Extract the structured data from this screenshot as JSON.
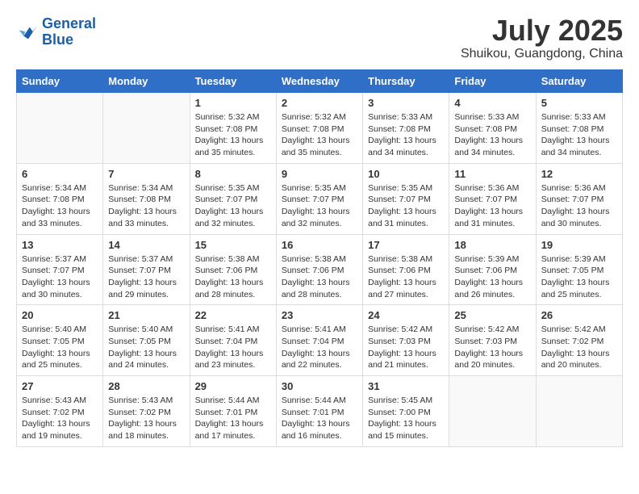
{
  "logo": {
    "line1": "General",
    "line2": "Blue"
  },
  "title": "July 2025",
  "location": "Shuikou, Guangdong, China",
  "headers": [
    "Sunday",
    "Monday",
    "Tuesday",
    "Wednesday",
    "Thursday",
    "Friday",
    "Saturday"
  ],
  "weeks": [
    [
      {
        "day": "",
        "info": ""
      },
      {
        "day": "",
        "info": ""
      },
      {
        "day": "1",
        "info": "Sunrise: 5:32 AM\nSunset: 7:08 PM\nDaylight: 13 hours\nand 35 minutes."
      },
      {
        "day": "2",
        "info": "Sunrise: 5:32 AM\nSunset: 7:08 PM\nDaylight: 13 hours\nand 35 minutes."
      },
      {
        "day": "3",
        "info": "Sunrise: 5:33 AM\nSunset: 7:08 PM\nDaylight: 13 hours\nand 34 minutes."
      },
      {
        "day": "4",
        "info": "Sunrise: 5:33 AM\nSunset: 7:08 PM\nDaylight: 13 hours\nand 34 minutes."
      },
      {
        "day": "5",
        "info": "Sunrise: 5:33 AM\nSunset: 7:08 PM\nDaylight: 13 hours\nand 34 minutes."
      }
    ],
    [
      {
        "day": "6",
        "info": "Sunrise: 5:34 AM\nSunset: 7:08 PM\nDaylight: 13 hours\nand 33 minutes."
      },
      {
        "day": "7",
        "info": "Sunrise: 5:34 AM\nSunset: 7:08 PM\nDaylight: 13 hours\nand 33 minutes."
      },
      {
        "day": "8",
        "info": "Sunrise: 5:35 AM\nSunset: 7:07 PM\nDaylight: 13 hours\nand 32 minutes."
      },
      {
        "day": "9",
        "info": "Sunrise: 5:35 AM\nSunset: 7:07 PM\nDaylight: 13 hours\nand 32 minutes."
      },
      {
        "day": "10",
        "info": "Sunrise: 5:35 AM\nSunset: 7:07 PM\nDaylight: 13 hours\nand 31 minutes."
      },
      {
        "day": "11",
        "info": "Sunrise: 5:36 AM\nSunset: 7:07 PM\nDaylight: 13 hours\nand 31 minutes."
      },
      {
        "day": "12",
        "info": "Sunrise: 5:36 AM\nSunset: 7:07 PM\nDaylight: 13 hours\nand 30 minutes."
      }
    ],
    [
      {
        "day": "13",
        "info": "Sunrise: 5:37 AM\nSunset: 7:07 PM\nDaylight: 13 hours\nand 30 minutes."
      },
      {
        "day": "14",
        "info": "Sunrise: 5:37 AM\nSunset: 7:07 PM\nDaylight: 13 hours\nand 29 minutes."
      },
      {
        "day": "15",
        "info": "Sunrise: 5:38 AM\nSunset: 7:06 PM\nDaylight: 13 hours\nand 28 minutes."
      },
      {
        "day": "16",
        "info": "Sunrise: 5:38 AM\nSunset: 7:06 PM\nDaylight: 13 hours\nand 28 minutes."
      },
      {
        "day": "17",
        "info": "Sunrise: 5:38 AM\nSunset: 7:06 PM\nDaylight: 13 hours\nand 27 minutes."
      },
      {
        "day": "18",
        "info": "Sunrise: 5:39 AM\nSunset: 7:06 PM\nDaylight: 13 hours\nand 26 minutes."
      },
      {
        "day": "19",
        "info": "Sunrise: 5:39 AM\nSunset: 7:05 PM\nDaylight: 13 hours\nand 25 minutes."
      }
    ],
    [
      {
        "day": "20",
        "info": "Sunrise: 5:40 AM\nSunset: 7:05 PM\nDaylight: 13 hours\nand 25 minutes."
      },
      {
        "day": "21",
        "info": "Sunrise: 5:40 AM\nSunset: 7:05 PM\nDaylight: 13 hours\nand 24 minutes."
      },
      {
        "day": "22",
        "info": "Sunrise: 5:41 AM\nSunset: 7:04 PM\nDaylight: 13 hours\nand 23 minutes."
      },
      {
        "day": "23",
        "info": "Sunrise: 5:41 AM\nSunset: 7:04 PM\nDaylight: 13 hours\nand 22 minutes."
      },
      {
        "day": "24",
        "info": "Sunrise: 5:42 AM\nSunset: 7:03 PM\nDaylight: 13 hours\nand 21 minutes."
      },
      {
        "day": "25",
        "info": "Sunrise: 5:42 AM\nSunset: 7:03 PM\nDaylight: 13 hours\nand 20 minutes."
      },
      {
        "day": "26",
        "info": "Sunrise: 5:42 AM\nSunset: 7:02 PM\nDaylight: 13 hours\nand 20 minutes."
      }
    ],
    [
      {
        "day": "27",
        "info": "Sunrise: 5:43 AM\nSunset: 7:02 PM\nDaylight: 13 hours\nand 19 minutes."
      },
      {
        "day": "28",
        "info": "Sunrise: 5:43 AM\nSunset: 7:02 PM\nDaylight: 13 hours\nand 18 minutes."
      },
      {
        "day": "29",
        "info": "Sunrise: 5:44 AM\nSunset: 7:01 PM\nDaylight: 13 hours\nand 17 minutes."
      },
      {
        "day": "30",
        "info": "Sunrise: 5:44 AM\nSunset: 7:01 PM\nDaylight: 13 hours\nand 16 minutes."
      },
      {
        "day": "31",
        "info": "Sunrise: 5:45 AM\nSunset: 7:00 PM\nDaylight: 13 hours\nand 15 minutes."
      },
      {
        "day": "",
        "info": ""
      },
      {
        "day": "",
        "info": ""
      }
    ]
  ]
}
